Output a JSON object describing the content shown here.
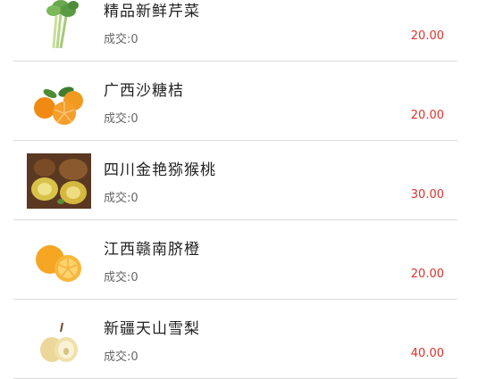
{
  "products": [
    {
      "name": "精品新鲜芹菜",
      "deal_label": "成交:",
      "deal_count": "0",
      "price": "20.00",
      "image_icon": "celery-image"
    },
    {
      "name": "广西沙糖桔",
      "deal_label": "成交:",
      "deal_count": "0",
      "price": "20.00",
      "image_icon": "tangerine-image"
    },
    {
      "name": "四川金艳猕猴桃",
      "deal_label": "成交:",
      "deal_count": "0",
      "price": "30.00",
      "image_icon": "kiwi-image"
    },
    {
      "name": "江西赣南脐橙",
      "deal_label": "成交:",
      "deal_count": "0",
      "price": "20.00",
      "image_icon": "orange-image"
    },
    {
      "name": "新疆天山雪梨",
      "deal_label": "成交:",
      "deal_count": "0",
      "price": "40.00",
      "image_icon": "pear-image"
    }
  ],
  "colors": {
    "price": "#e0322b",
    "divider": "#dcdcdc"
  }
}
